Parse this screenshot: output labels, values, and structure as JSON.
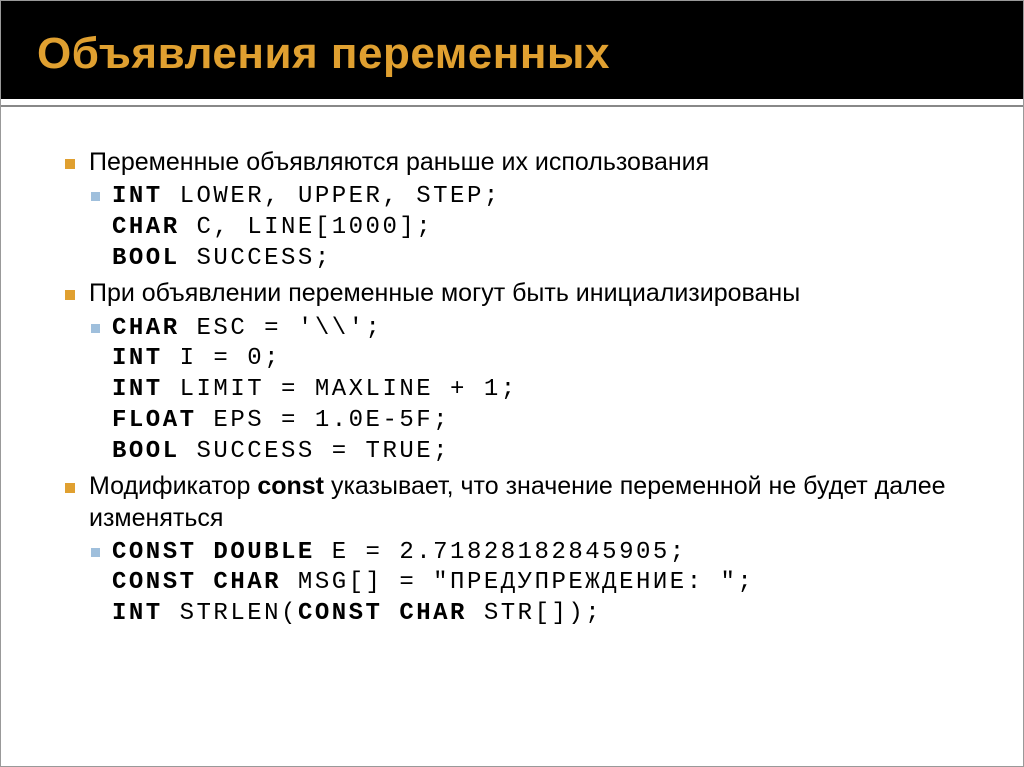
{
  "title": "Объявления переменных",
  "bullets": {
    "b1": "Переменные объявляются раньше их использования",
    "code1": {
      "l1a": "INT",
      "l1b": " LOWER, UPPER, STEP;",
      "l2a": "CHAR",
      "l2b": " C, LINE[1000];",
      "l3a": "BOOL",
      "l3b": " SUCCESS;"
    },
    "b2": "При объявлении переменные могут быть инициализированы",
    "code2": {
      "l1a": "CHAR",
      "l1b": " ESC = '\\\\';",
      "l2a": "INT",
      "l2b": " I = 0;",
      "l3a": "INT",
      "l3b": " LIMIT = MAXLINE + 1;",
      "l4a": "FLOAT",
      "l4b": " EPS = 1.0E-5F;",
      "l5a": "BOOL",
      "l5b": " SUCCESS = TRUE;"
    },
    "b3_pre": "Модификатор ",
    "b3_kw": "const",
    "b3_post": " указывает, что значение переменной не будет далее изменяться",
    "code3": {
      "l1a": "CONST DOUBLE",
      "l1b": " E = 2.71828182845905;",
      "l2a": "CONST CHAR",
      "l2b": " MSG[] = \"ПРЕДУПРЕЖДЕНИЕ: \";",
      "l3a": "INT",
      "l3b": " STRLEN(",
      "l3c": "CONST CHAR",
      "l3d": " STR[]);"
    }
  }
}
